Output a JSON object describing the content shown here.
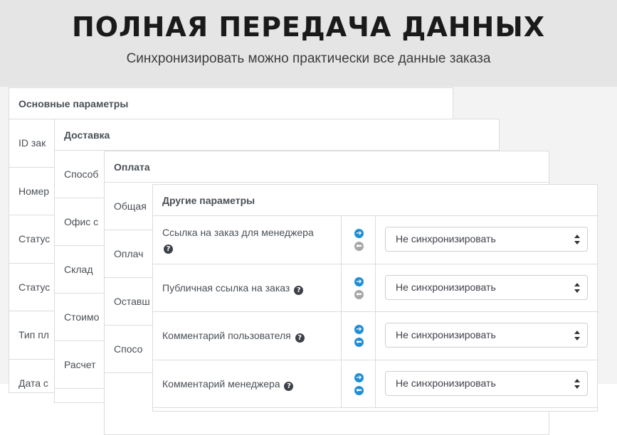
{
  "hero": {
    "title": "ПОЛНАЯ ПЕРЕДАЧА ДАННЫХ",
    "subtitle": "Синхронизировать можно практически все данные заказа"
  },
  "panels": {
    "main": {
      "title": "Основные параметры",
      "rows": [
        "ID зак",
        "Номер",
        "Статус",
        "Статус",
        "Тип пл",
        "Дата с"
      ]
    },
    "delivery": {
      "title": "Доставка",
      "rows": [
        "Способ",
        "Офис с",
        "Склад",
        "Стоимо",
        "Расчет"
      ]
    },
    "payment": {
      "title": "Оплата",
      "rows": [
        "Общая",
        "Оплач",
        "Оставш",
        "Спосо"
      ]
    },
    "other": {
      "title": "Другие параметры",
      "rows": [
        {
          "label": "Ссылка на заказ для менеджера",
          "help": "?",
          "sync_up": "active",
          "sync_down": "inactive",
          "select": "Не синхронизировать"
        },
        {
          "label": "Публичная ссылка на заказ",
          "help": "?",
          "sync_up": "active",
          "sync_down": "inactive",
          "select": "Не синхронизировать"
        },
        {
          "label": "Комментарий пользователя",
          "help": "?",
          "sync_up": "active",
          "sync_down": "active",
          "select": "Не синхронизировать"
        },
        {
          "label": "Комментарий менеджера",
          "help": "?",
          "sync_up": "active",
          "sync_down": "active",
          "select": "Не синхронизировать"
        }
      ]
    }
  },
  "icons": {
    "arrow_up": "arrow-right-circle-icon",
    "arrow_down": "arrow-left-circle-icon",
    "help": "question-circle-icon"
  },
  "colors": {
    "active_arrow": "#1e8fd6",
    "inactive_arrow": "#a7a7a7",
    "hero_bg": "#e5e5e5"
  }
}
